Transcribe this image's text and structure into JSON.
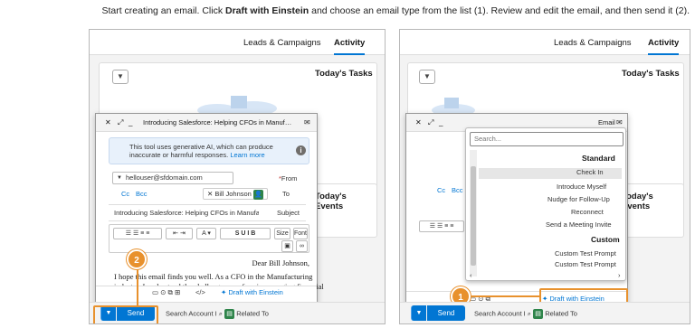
{
  "caption": {
    "prefix": "Start creating an email. Click ",
    "bold": "Draft with Einstein",
    "suffix": " and choose an email type from the list (1). Review and edit the email, and then send it (2)."
  },
  "tabs": {
    "activity": "Activity",
    "leads": "Leads & Campaigns"
  },
  "cards": {
    "tasks": "Today's Tasks",
    "events": "Today's Events"
  },
  "composer_left": {
    "title": "Introducing Salesforce: Helping CFOs in Manufacturin...",
    "notice": "This tool uses generative AI, which can produce inaccurate or harmful responses.",
    "learn_more": "Learn more",
    "from_label": "From",
    "from_value": "hellouser@sfdomain.com",
    "to_label": "To",
    "to_value": "Bill Johnson",
    "cc": "Cc",
    "bcc": "Bcc",
    "subject_label": "Subject",
    "subject_value": "Introducing Salesforce: Helping CFOs in Manufacturin",
    "font_label": "Font",
    "size_label": "Size",
    "body_greeting": "Dear Bill Johnson,",
    "body_text_1": "I hope this email finds you well. As a CFO in the Manufacturing",
    "body_text_2": "industry, I understand the challenges you face in managing financial",
    "draft_button": "Draft with Einstein",
    "send": "Send",
    "related_label": "Related To",
    "related_value": "Search Account I"
  },
  "composer_right": {
    "title": "Email",
    "cc": "Cc",
    "bcc": "Bcc",
    "draft_button": "Draft with Einstein",
    "send": "Send",
    "related_label": "Related To",
    "related_value": "Search Account I"
  },
  "einstein_menu": {
    "search_placeholder": "Search...",
    "section_standard": "Standard",
    "standard_items": [
      "Check In",
      "Introduce Myself",
      "Nudge for Follow-Up",
      "Reconnect",
      "Send a Meeting Invite"
    ],
    "section_custom": "Custom",
    "custom_items": [
      "Custom Test Prompt",
      "Custom Test Prompt"
    ]
  },
  "badges": {
    "one": "1",
    "two": "2"
  },
  "colors": {
    "brand": "#0176d3",
    "highlight": "#e8912d",
    "relatedIcon": "#2e844a"
  }
}
